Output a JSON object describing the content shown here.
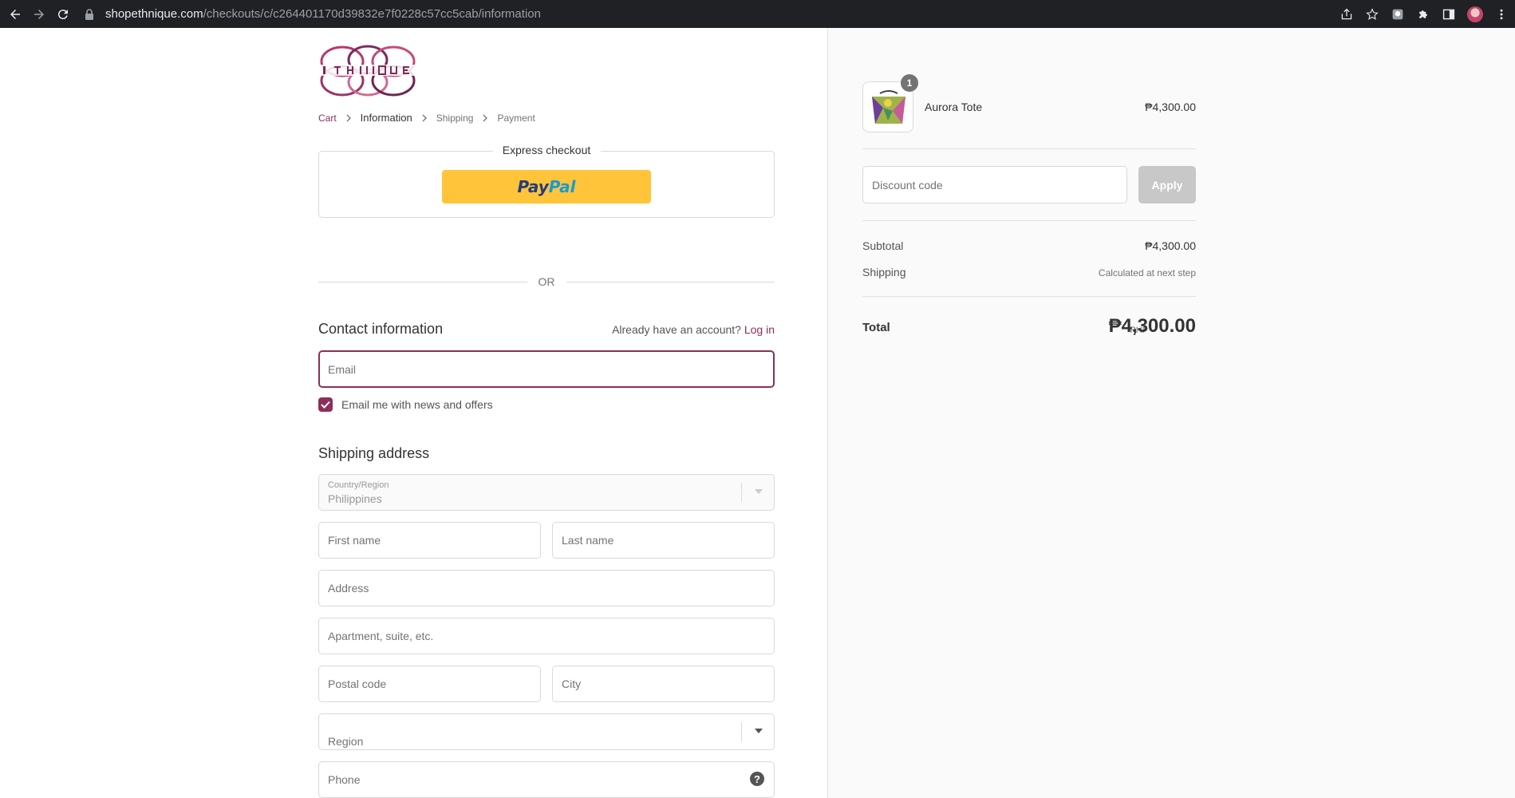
{
  "browser": {
    "url_host": "shopethnique.com",
    "url_path": "/checkouts/c/c264401170d39832e7f0228c57cc5cab/information"
  },
  "checkout": {
    "breadcrumb": [
      "Cart",
      "Information",
      "Shipping",
      "Payment"
    ],
    "express_title": "Express checkout",
    "paypal_part1": "Pay",
    "paypal_part2": "Pal",
    "or_text": "OR",
    "contact_title": "Contact information",
    "account_prompt": "Already have an account?",
    "login_link": "Log in",
    "email_placeholder": "Email",
    "newsletter_label": "Email me with news and offers",
    "newsletter_checked": true,
    "shipping_title": "Shipping address",
    "country_label": "Country/Region",
    "country_value": "Philippines",
    "first_name_placeholder": "First name",
    "last_name_placeholder": "Last name",
    "address_placeholder": "Address",
    "apartment_placeholder": "Apartment, suite, etc.",
    "postal_placeholder": "Postal code",
    "city_placeholder": "City",
    "region_placeholder": "Region",
    "phone_placeholder": "Phone",
    "help_glyph": "?"
  },
  "summary": {
    "quantity": "1",
    "product_name": "Aurora Tote",
    "product_price": "₱4,300.00",
    "discount_placeholder": "Discount code",
    "apply_label": "Apply",
    "subtotal_label": "Subtotal",
    "subtotal_value": "₱4,300.00",
    "shipping_label": "Shipping",
    "shipping_value": "Calculated at next step",
    "total_label": "Total",
    "currency": "PHP",
    "total_value": "₱4,300.00"
  },
  "colors": {
    "accent": "#8c2f5a",
    "paypal_yellow": "#ffc439",
    "chrome_bg": "#202124"
  },
  "icons": [
    "back-arrow-icon",
    "forward-arrow-icon",
    "reload-icon",
    "lock-icon",
    "share-icon",
    "star-icon",
    "extension-icon",
    "puzzle-icon",
    "sidepanel-icon",
    "profile-avatar",
    "menu-dots-icon",
    "chevron-right-icon",
    "chevron-down-icon",
    "checkmark-icon",
    "help-icon"
  ]
}
